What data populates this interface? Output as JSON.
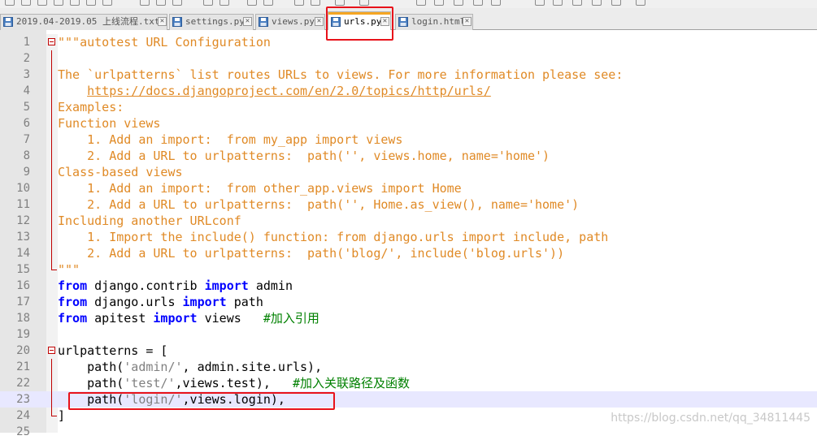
{
  "tabs": [
    {
      "label": "2019.04-2019.05 上线流程.txt",
      "active": false
    },
    {
      "label": "settings.py",
      "active": false
    },
    {
      "label": "views.py",
      "active": false
    },
    {
      "label": "urls.py",
      "active": true
    },
    {
      "label": "login.html",
      "active": false
    }
  ],
  "tab_close_glyph": "✕",
  "code": {
    "line_numbers": [
      "1",
      "2",
      "3",
      "4",
      "5",
      "6",
      "7",
      "8",
      "9",
      "10",
      "11",
      "12",
      "13",
      "14",
      "15",
      "16",
      "17",
      "18",
      "19",
      "20",
      "21",
      "22",
      "23",
      "24",
      "25"
    ],
    "line1": "\"\"\"autotest URL Configuration",
    "line3": "The `urlpatterns` list routes URLs to views. For more information please see:",
    "line4_indent": "    ",
    "line4_link": "https://docs.djangoproject.com/en/2.0/topics/http/urls/",
    "line5": "Examples:",
    "line6": "Function views",
    "line7": "    1. Add an import:  from my_app import views",
    "line8": "    2. Add a URL to urlpatterns:  path('', views.home, name='home')",
    "line9": "Class-based views",
    "line10": "    1. Add an import:  from other_app.views import Home",
    "line11": "    2. Add a URL to urlpatterns:  path('', Home.as_view(), name='home')",
    "line12": "Including another URLconf",
    "line13": "    1. Import the include() function: from django.urls import include, path",
    "line14": "    2. Add a URL to urlpatterns:  path('blog/', include('blog.urls'))",
    "line15": "\"\"\"",
    "kw_from": "from",
    "kw_import": "import",
    "line16_mod": " django.contrib ",
    "line16_name": " admin",
    "line17_mod": " django.urls ",
    "line17_name": " path",
    "line18_mod": " apitest ",
    "line18_name": " views   ",
    "line18_comment": "#加入引用",
    "line20": "urlpatterns = [",
    "line21_a": "    path(",
    "line21_str": "'admin/'",
    "line21_b": ", admin.site.urls),",
    "line22_a": "    path(",
    "line22_str": "'test/'",
    "line22_b": ",views.test),   ",
    "line22_comment": "#加入关联路径及函数",
    "line23_a": "    path(",
    "line23_str": "'login/'",
    "line23_b": ",views.login),",
    "line24": "]"
  },
  "watermark": "https://blog.csdn.net/qq_34811445",
  "colors": {
    "string": "#e08a26",
    "keyword": "#0000ff",
    "comment": "#008000",
    "highlight_box": "#e8121a",
    "current_line": "#e8e8ff"
  }
}
